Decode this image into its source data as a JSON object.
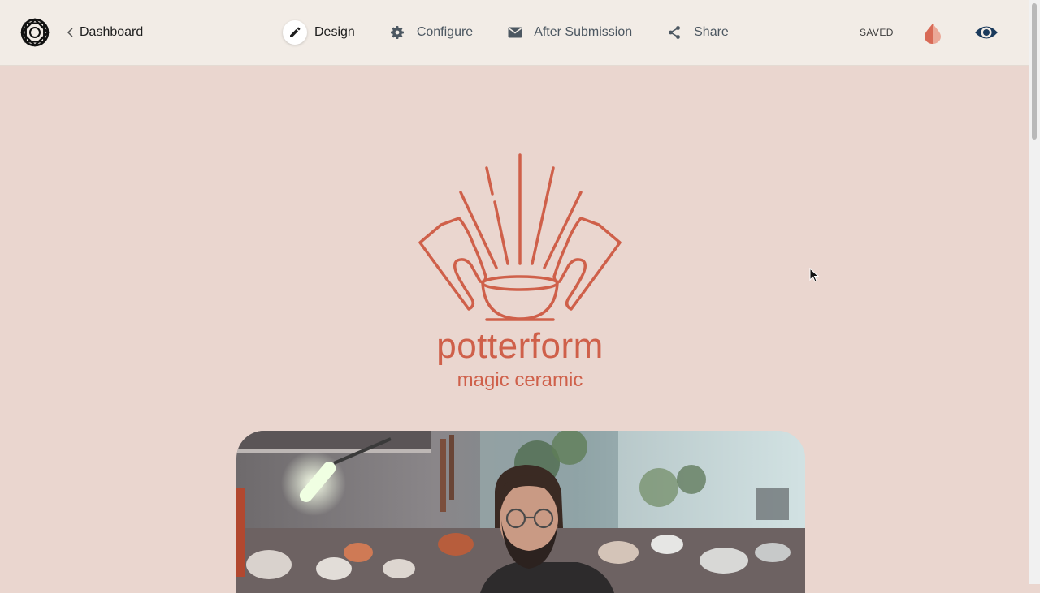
{
  "header": {
    "back_label": "Dashboard",
    "tabs": [
      {
        "label": "Design",
        "icon": "pencil-icon",
        "active": true
      },
      {
        "label": "Configure",
        "icon": "gear-icon",
        "active": false
      },
      {
        "label": "After Submission",
        "icon": "envelope-icon",
        "active": false
      },
      {
        "label": "Share",
        "icon": "share-icon",
        "active": false
      }
    ],
    "status": "SAVED",
    "theme_icon": "color-drop-icon",
    "preview_icon": "eye-icon"
  },
  "brand": {
    "name": "potterform",
    "tagline": "magic ceramic",
    "color": "#cf604a"
  },
  "hero": {
    "image": "potter-in-workshop-photo"
  },
  "colors": {
    "page_background": "#ead6cf",
    "header_background": "#f2ece6",
    "accent": "#cf604a",
    "preview_icon": "#1b3a5c"
  }
}
